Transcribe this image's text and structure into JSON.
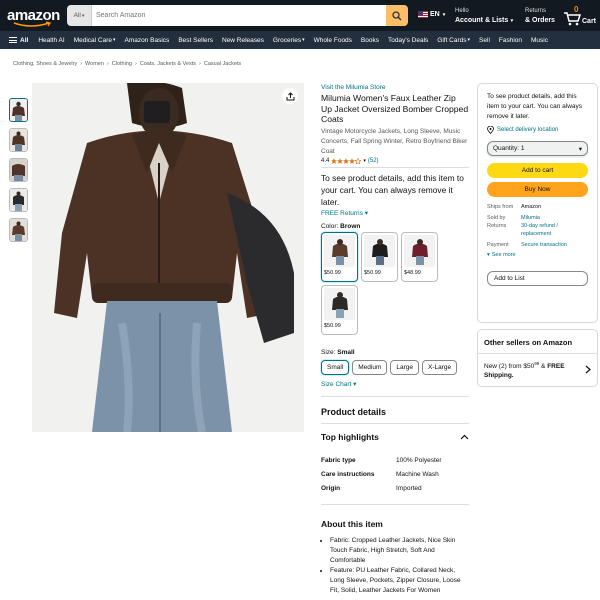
{
  "header": {
    "logo": "amazon",
    "search_category": "All",
    "search_placeholder": "Search Amazon",
    "language": "EN",
    "account_greeting": "Hello",
    "account_label": "Account & Lists",
    "returns_label": "Returns",
    "orders_label": "& Orders",
    "cart_count": "0",
    "cart_label": "Cart"
  },
  "nav": {
    "all_label": "All",
    "items": [
      "Health AI",
      "Medical Care",
      "Amazon Basics",
      "Best Sellers",
      "New Releases",
      "Groceries",
      "Whole Foods",
      "Books",
      "Today's Deals",
      "Gift Cards",
      "Sell",
      "Fashion",
      "Music"
    ]
  },
  "breadcrumb": [
    "Clothing, Shoes & Jewelry",
    "Women",
    "Clothing",
    "Coats, Jackets & Vests",
    "Casual Jackets"
  ],
  "product": {
    "store_link": "Visit the Milumia Store",
    "title": "Milumia Women's Faux Leather Zip Up Jacket Oversized Bomber Cropped Coats",
    "description": "Vintage Motorcycle Jackets, Long Sleeve, Music Concerts, Fall Spring Winter, Retro Boyfriend Biker Coat",
    "rating_value": "4.4",
    "rating_count": "(52)",
    "price_notice": "To see product details, add this item to your cart. You can always remove it later.",
    "returns_link": "FREE Returns",
    "color_label": "Color:",
    "color_selected": "Brown",
    "swatches": [
      {
        "price": "$50.99",
        "color": "#5b3d2e"
      },
      {
        "price": "$50.99",
        "color": "#1d1d1f"
      },
      {
        "price": "$48.99",
        "color": "#6e1f2c"
      },
      {
        "price": "$50.99",
        "color": "#2c2a28"
      }
    ],
    "size_label": "Size:",
    "size_selected": "Small",
    "sizes": [
      "Small",
      "Medium",
      "Large",
      "X-Large"
    ],
    "size_chart": "Size Chart"
  },
  "details": {
    "heading": "Product details",
    "highlights_heading": "Top highlights",
    "specs": [
      {
        "key": "Fabric type",
        "value": "100% Polyester"
      },
      {
        "key": "Care instructions",
        "value": "Machine Wash"
      },
      {
        "key": "Origin",
        "value": "Imported"
      }
    ],
    "about_heading": "About this item",
    "about_items": [
      "Fabric: Cropped Leather Jackets, Nice Skin Touch Fabric, High Stretch, Soft And Comfortable",
      "Feature: PU Leather Fabric, Collared Neck, Long Sleeve, Pockets, Zipper Closure, Loose Fit, Solid, Leather Jackets For Women"
    ]
  },
  "buybox": {
    "notice": "To see product details, add this item to your cart. You can always remove it later.",
    "deliver_link": "Select delivery location",
    "qty_label": "Quantity:",
    "qty_value": "1",
    "add_to_cart": "Add to cart",
    "buy_now": "Buy Now",
    "ships_from_key": "Ships from",
    "ships_from_val": "Amazon",
    "sold_by_key": "Sold by",
    "sold_by_val": "Milumia",
    "returns_key": "Returns",
    "returns_val": "30-day refund / replacement",
    "payment_key": "Payment",
    "payment_val": "Secure transaction",
    "see_more": "See more",
    "add_to_list": "Add to List"
  },
  "other_sellers": {
    "heading": "Other sellers on Amazon",
    "new_text": "New (2) from",
    "price_main": "$50",
    "price_cents": "99",
    "shipping": "FREE Shipping."
  },
  "colors": {
    "topbar": "#131921",
    "navbar": "#232f3e",
    "link": "#007185",
    "cart_btn": "#ffd814",
    "buy_btn": "#ffa41c",
    "search_btn": "#febd69"
  }
}
